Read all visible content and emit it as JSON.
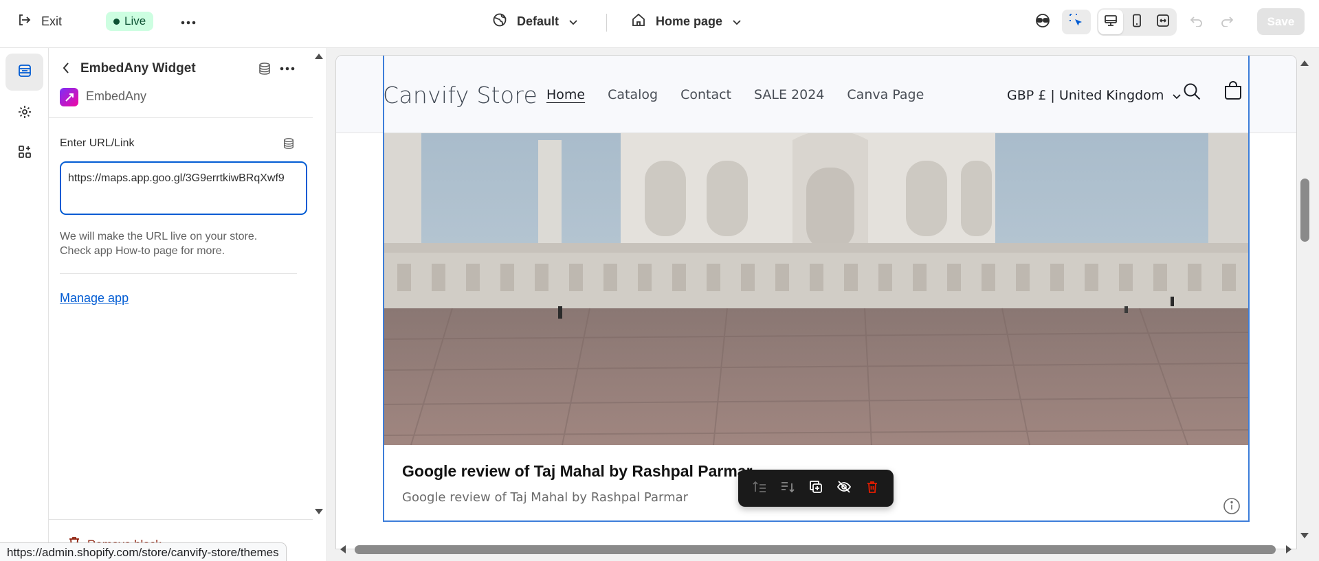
{
  "topbar": {
    "exit_label": "Exit",
    "live_label": "Live",
    "theme_label": "Default",
    "page_label": "Home page",
    "save_label": "Save"
  },
  "panel": {
    "title": "EmbedAny Widget",
    "app_name": "EmbedAny",
    "field_label": "Enter URL/Link",
    "url_value": "https://maps.app.goo.gl/3G9errtkiwBRqXwf9",
    "help_text": "We will make the URL live on your store. Check app How-to page for more.",
    "manage_link": "Manage app",
    "remove_label": "Remove block"
  },
  "status_url": "https://admin.shopify.com/store/canvify-store/themes",
  "store": {
    "logo": "Canvify Store",
    "nav": [
      "Home",
      "Catalog",
      "Contact",
      "SALE 2024",
      "Canva Page"
    ],
    "currency": "GBP £ | United Kingdom"
  },
  "review": {
    "title": "Google review of Taj Mahal by Rashpal Parmar",
    "subtitle": "Google review of Taj Mahal by Rashpal Parmar"
  },
  "colors": {
    "live_bg": "#cdfee1",
    "accent_blue": "#005bd3",
    "selection_blue": "#3c7dd9",
    "delete_red": "#e51c00"
  }
}
